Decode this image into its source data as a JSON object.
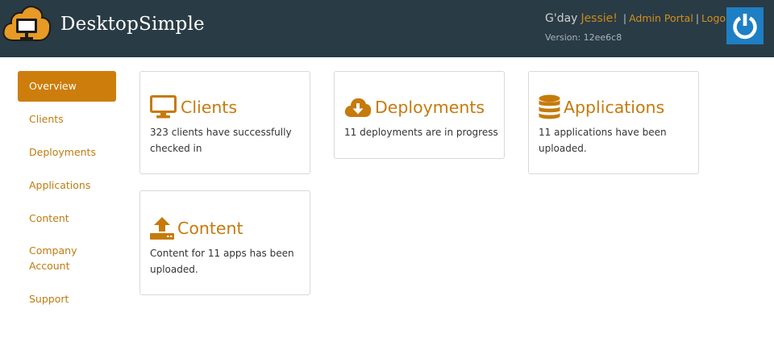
{
  "header": {
    "brand": "DesktopSimple",
    "greeting_prefix": "G'day",
    "user_name": "Jessie!",
    "links": [
      "Admin Portal",
      "Logout"
    ],
    "separator": "|",
    "version": "Version: 12ee6c8",
    "colors": {
      "bar": "#293b45",
      "accent": "#d48e1d",
      "power": "#1e7fc4"
    },
    "icons": {
      "logo": "cloud-monitor-icon",
      "power": "power-icon"
    }
  },
  "sidebar": {
    "items": [
      {
        "label": "Overview",
        "active": true
      },
      {
        "label": "Clients",
        "active": false
      },
      {
        "label": "Deployments",
        "active": false
      },
      {
        "label": "Applications",
        "active": false
      },
      {
        "label": "Content",
        "active": false
      },
      {
        "label": "Company Account",
        "active": false
      },
      {
        "label": "Support",
        "active": false
      }
    ]
  },
  "cards": [
    {
      "title": "Clients",
      "text": "323 clients have successfully checked in",
      "icon": "monitor-icon"
    },
    {
      "title": "Deployments",
      "text": "11 deployments are in progress",
      "icon": "cloud-download-icon"
    },
    {
      "title": "Applications",
      "text": "11 applications have been uploaded.",
      "icon": "database-icon"
    },
    {
      "title": "Content",
      "text": "Content for 11 apps has been uploaded.",
      "icon": "upload-icon"
    }
  ]
}
